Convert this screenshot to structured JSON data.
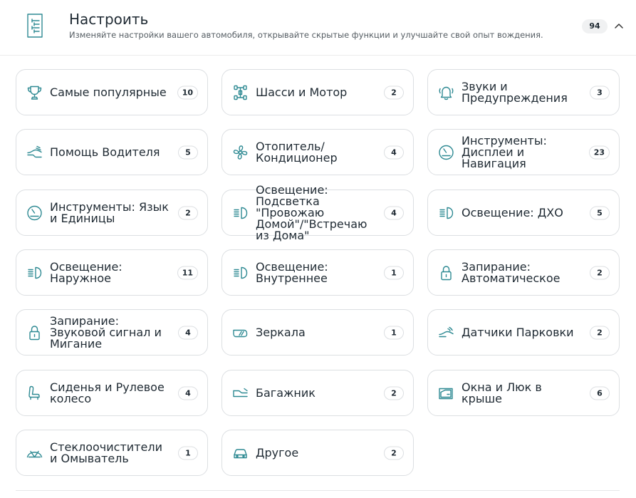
{
  "header": {
    "title": "Настроить",
    "subtitle": "Изменяйте настройки вашего автомобиля, открывайте скрытые функции и улучшайте свой опыт вождения.",
    "total": "94"
  },
  "colors": {
    "accent": "#2f8a93",
    "border": "#dcdfe2",
    "text": "#1f2a33"
  },
  "categories": [
    {
      "label": "Самые популярные",
      "count": "10",
      "icon": "trophy-icon"
    },
    {
      "label": "Шасси и Мотор",
      "count": "2",
      "icon": "chassis-icon"
    },
    {
      "label": "Звуки и Предупреждения",
      "count": "3",
      "icon": "bell-icon"
    },
    {
      "label": "Помощь Водителя",
      "count": "5",
      "icon": "driver-assist-icon"
    },
    {
      "label": "Отопитель/ Кондиционер",
      "count": "4",
      "icon": "fan-icon"
    },
    {
      "label": "Инструменты: Дисплеи и Навигация",
      "count": "23",
      "icon": "gauge-icon"
    },
    {
      "label": "Инструменты: Язык и Единицы",
      "count": "2",
      "icon": "gauge-icon"
    },
    {
      "label": "Освещение: Подсветка \"Провожаю Домой\"/\"Встречаю из Дома\"",
      "count": "4",
      "icon": "headlight-icon"
    },
    {
      "label": "Освещение: ДХО",
      "count": "5",
      "icon": "headlight-icon"
    },
    {
      "label": "Освещение: Наружное",
      "count": "11",
      "icon": "headlight-icon"
    },
    {
      "label": "Освещение: Внутреннее",
      "count": "1",
      "icon": "headlight-icon"
    },
    {
      "label": "Запирание: Автоматическое",
      "count": "2",
      "icon": "lock-icon"
    },
    {
      "label": "Запирание: Звуковой сигнал и Мигание",
      "count": "4",
      "icon": "lock-icon"
    },
    {
      "label": "Зеркала",
      "count": "1",
      "icon": "mirror-icon"
    },
    {
      "label": "Датчики Парковки",
      "count": "2",
      "icon": "parking-sensor-icon"
    },
    {
      "label": "Сиденья и Рулевое колесо",
      "count": "4",
      "icon": "seat-icon"
    },
    {
      "label": "Багажник",
      "count": "2",
      "icon": "trunk-icon"
    },
    {
      "label": "Окна и Люк в крыше",
      "count": "6",
      "icon": "window-icon"
    },
    {
      "label": "Стеклоочистители и Омыватель",
      "count": "1",
      "icon": "wiper-icon"
    },
    {
      "label": "Другое",
      "count": "2",
      "icon": "car-icon"
    }
  ]
}
